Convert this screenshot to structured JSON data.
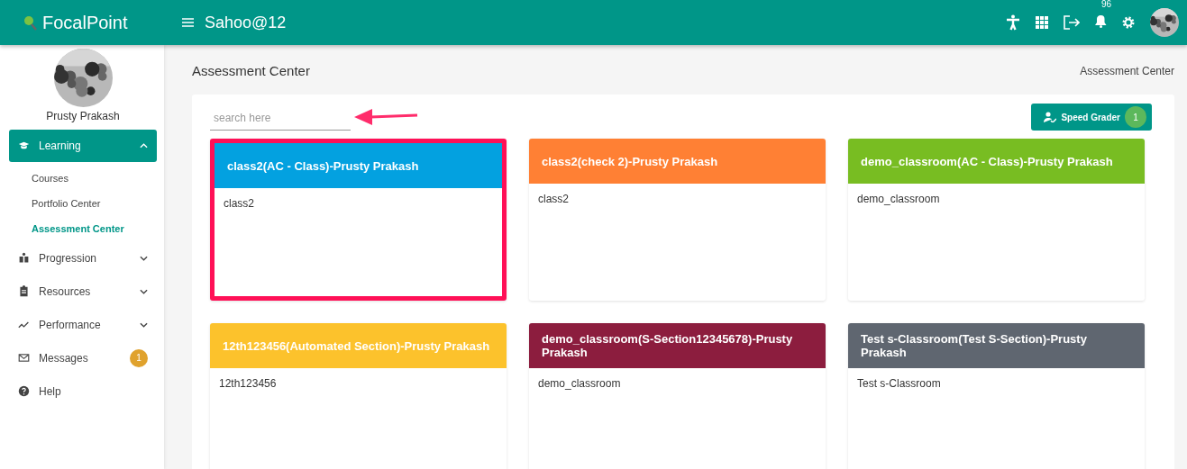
{
  "header": {
    "logo": "FocalPoint",
    "title": "Sahoo@12",
    "notification_count": "96"
  },
  "profile": {
    "name": "Prusty Prakash"
  },
  "sidebar": {
    "items": [
      {
        "label": "Learning",
        "kind": "menu",
        "expanded": true,
        "selected": true,
        "children": [
          {
            "label": "Courses",
            "selected": false
          },
          {
            "label": "Portfolio Center",
            "selected": false
          },
          {
            "label": "Assessment Center",
            "selected": true
          }
        ]
      },
      {
        "label": "Progression",
        "kind": "menu",
        "expanded": false,
        "selected": false
      },
      {
        "label": "Resources",
        "kind": "menu",
        "expanded": false,
        "selected": false
      },
      {
        "label": "Performance",
        "kind": "menu",
        "expanded": false,
        "selected": false
      },
      {
        "label": "Messages",
        "kind": "link",
        "selected": false,
        "badge": "1"
      },
      {
        "label": "Help",
        "kind": "link",
        "selected": false
      }
    ]
  },
  "page": {
    "title": "Assessment Center",
    "breadcrumb": "Assessment Center"
  },
  "search": {
    "placeholder": "search here"
  },
  "speed_grader": {
    "label": "Speed Grader",
    "count": "1"
  },
  "cards": [
    {
      "title": "class2(AC - Class)-Prusty Prakash",
      "body": "class2",
      "color": "#03a1e0",
      "highlighted": true
    },
    {
      "title": "class2(check 2)-Prusty Prakash",
      "body": "class2",
      "color": "#ff8034",
      "highlighted": false
    },
    {
      "title": "demo_classroom(AC - Class)-Prusty Prakash",
      "body": "demo_classroom",
      "color": "#78bd22",
      "highlighted": false
    },
    {
      "title": "12th123456(Automated Section)-Prusty Prakash",
      "body": "12th123456",
      "color": "#fcc22c",
      "highlighted": false
    },
    {
      "title": "demo_classroom(S-Section12345678)-Prusty Prakash",
      "body": "demo_classroom",
      "color": "#8c1d3e",
      "highlighted": false
    },
    {
      "title": "Test s-Classroom(Test S-Section)-Prusty Prakash",
      "body": "Test s-Classroom",
      "color": "#5f6670",
      "highlighted": false
    }
  ]
}
